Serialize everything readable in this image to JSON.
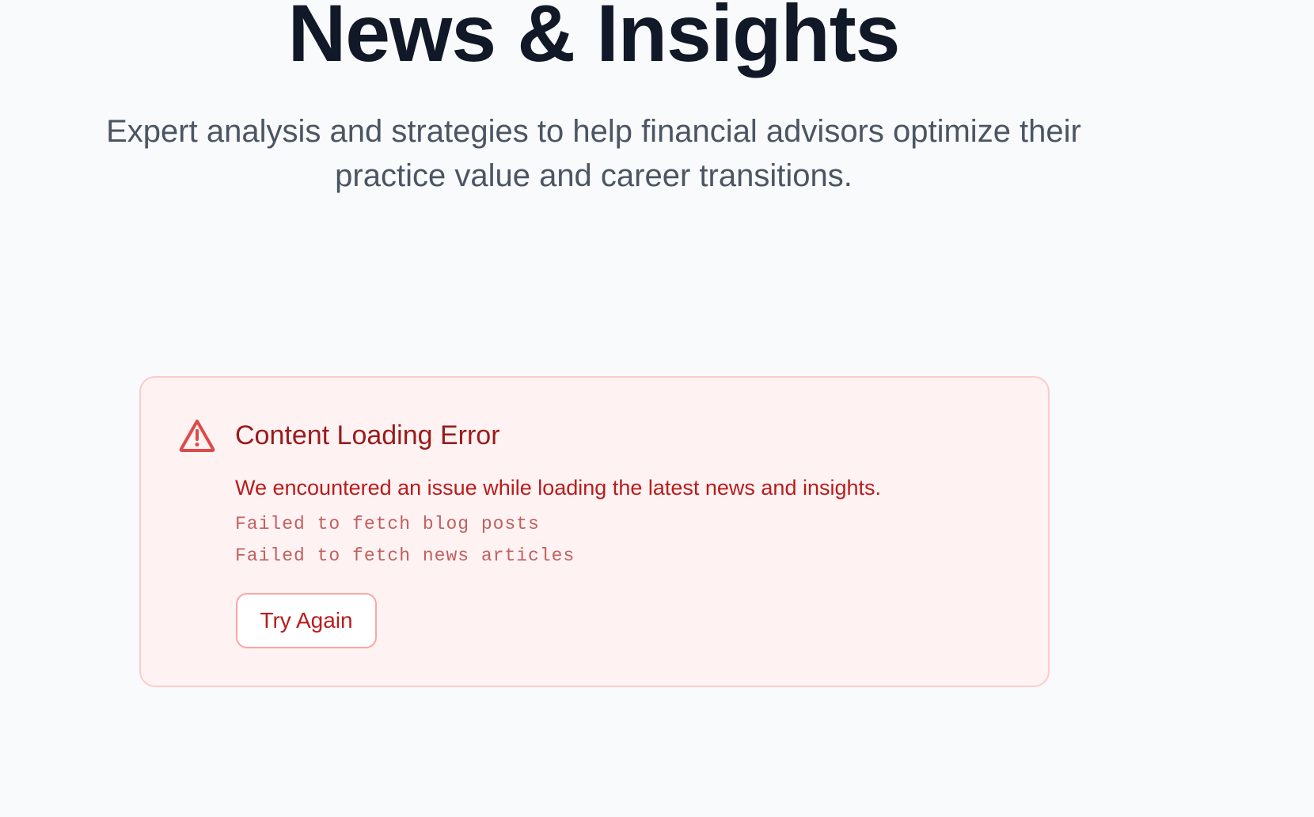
{
  "hero": {
    "title": "News & Insights",
    "subtitle": "Expert analysis and strategies to help financial advisors optimize their practice value and career transitions."
  },
  "error": {
    "icon": "warning-triangle-icon",
    "title": "Content Loading Error",
    "message": "We encountered an issue while loading the latest news and insights.",
    "details": [
      "Failed to fetch blog posts",
      "Failed to fetch news articles"
    ],
    "retry_label": "Try Again"
  },
  "colors": {
    "page_background": "#f9fafb",
    "title_text": "#111827",
    "subtitle_text": "#4b5563",
    "error_background": "#fef2f2",
    "error_border": "#fecaca",
    "error_title": "#991b1b",
    "error_text": "#b91c1c",
    "error_icon": "#dc4a4a"
  }
}
